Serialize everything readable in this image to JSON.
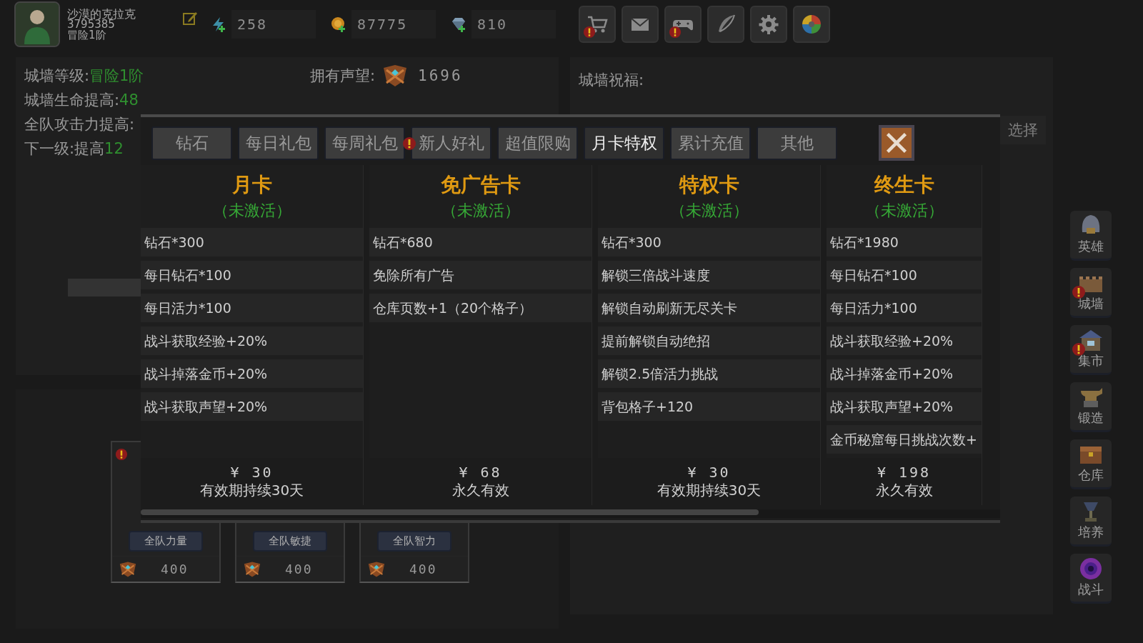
{
  "player": {
    "name": "沙漠的克拉克",
    "id": "3795385",
    "rank": "冒险1阶"
  },
  "resources": [
    {
      "kind": "stamina",
      "value": "258"
    },
    {
      "kind": "gold",
      "value": "87775"
    },
    {
      "kind": "diamond",
      "value": "810"
    }
  ],
  "toolbar": [
    {
      "kind": "cart",
      "alert": true
    },
    {
      "kind": "mail",
      "alert": false
    },
    {
      "kind": "gamepad",
      "alert": true
    },
    {
      "kind": "feather",
      "alert": false
    },
    {
      "kind": "gear",
      "alert": false
    },
    {
      "kind": "color-wheel",
      "alert": false
    }
  ],
  "wall": {
    "stats": [
      {
        "label": "城墙等级:",
        "value": "冒险1阶"
      },
      {
        "label": "城墙生命提高:",
        "value": "48"
      },
      {
        "label": "全队攻击力提高:"
      },
      {
        "label": "下一级:提高",
        "value": "12"
      }
    ],
    "reputation_label": "拥有声望:",
    "reputation": "1696",
    "blessing_label": "城墙祝福:",
    "select_button": "选择"
  },
  "upgrades": [
    {
      "label": "全队力量",
      "cost": "400",
      "alert": true
    },
    {
      "label": "全队敏捷",
      "cost": "400"
    },
    {
      "label": "全队智力",
      "cost": "400"
    }
  ],
  "shop": {
    "tabs": [
      {
        "label": "钻石",
        "selected": false,
        "alert": false
      },
      {
        "label": "每日礼包",
        "selected": false,
        "alert": false
      },
      {
        "label": "每周礼包",
        "selected": false,
        "alert": false
      },
      {
        "label": "新人好礼",
        "selected": false,
        "alert": true
      },
      {
        "label": "超值限购",
        "selected": false,
        "alert": false
      },
      {
        "label": "月卡特权",
        "selected": true,
        "alert": false
      },
      {
        "label": "累计充值",
        "selected": false,
        "alert": false
      },
      {
        "label": "其他",
        "selected": false,
        "alert": false
      }
    ],
    "cards": [
      {
        "title": "月卡",
        "status": "（未激活）",
        "items": [
          "钻石*300",
          "每日钻石*100",
          "每日活力*100",
          "战斗获取经验+20%",
          "战斗掉落金币+20%",
          "战斗获取声望+20%"
        ],
        "price": "¥ 30",
        "validity": "有效期持续30天"
      },
      {
        "title": "免广告卡",
        "status": "（未激活）",
        "items": [
          "钻石*680",
          "免除所有广告",
          "仓库页数+1（20个格子）"
        ],
        "price": "¥ 68",
        "validity": "永久有效"
      },
      {
        "title": "特权卡",
        "status": "（未激活）",
        "items": [
          "钻石*300",
          "解锁三倍战斗速度",
          "解锁自动刷新无尽关卡",
          "提前解锁自动绝招",
          "解锁2.5倍活力挑战",
          "背包格子+120"
        ],
        "price": "¥ 30",
        "validity": "有效期持续30天"
      },
      {
        "title": "终生卡",
        "status": "（未激活）",
        "items": [
          "钻石*1980",
          "每日钻石*100",
          "每日活力*100",
          "战斗获取经验+20%",
          "战斗掉落金币+20%",
          "战斗获取声望+20%",
          "金币秘窟每日挑战次数+"
        ],
        "price": "¥ 198",
        "validity": "永久有效"
      }
    ]
  },
  "sidebar": [
    {
      "kind": "helmet",
      "label": "英雄",
      "alert": false
    },
    {
      "kind": "wall",
      "label": "城墙",
      "alert": true
    },
    {
      "kind": "market",
      "label": "集市",
      "alert": true
    },
    {
      "kind": "anvil",
      "label": "锻造",
      "alert": false
    },
    {
      "kind": "chest",
      "label": "仓库",
      "alert": false
    },
    {
      "kind": "trophy",
      "label": "培养",
      "alert": false
    },
    {
      "kind": "portal",
      "label": "战斗",
      "alert": false
    }
  ]
}
